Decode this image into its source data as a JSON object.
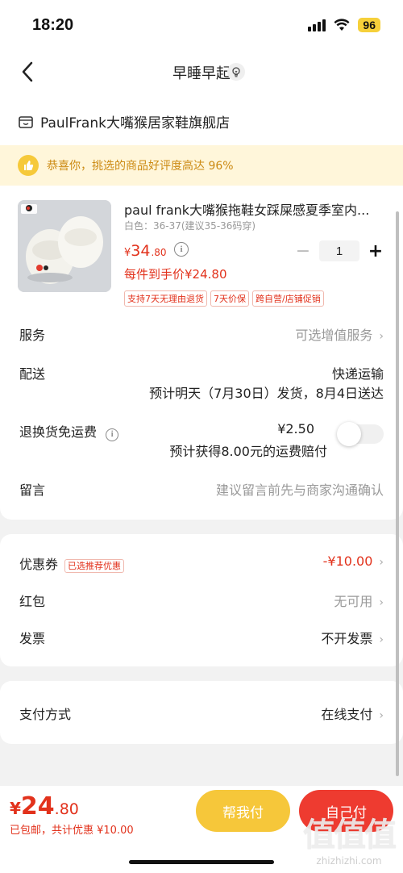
{
  "status": {
    "time": "18:20",
    "battery": "96"
  },
  "nav": {
    "title": "早睡早起"
  },
  "shop": {
    "name": "PaulFrank大嘴猴居家鞋旗舰店"
  },
  "banner": {
    "text": "恭喜你，挑选的商品好评度高达 96%"
  },
  "product": {
    "title": "paul frank大嘴猴拖鞋女踩屎感夏季室内...",
    "spec": "白色：36-37(建议35-36码穿)",
    "price_symbol": "¥",
    "price_int": "34",
    "price_dec": ".80",
    "quantity": "1",
    "unit_price": "每件到手价¥24.80",
    "tags": [
      "支持7天无理由退货",
      "7天价保",
      "跨自营/店铺促销"
    ]
  },
  "rows": {
    "service": {
      "label": "服务",
      "value": "可选增值服务"
    },
    "delivery": {
      "label": "配送",
      "value": "快递运输",
      "note": "预计明天（7月30日）发货，8月4日送达"
    },
    "return": {
      "label": "退换货免运费",
      "value": "¥2.50",
      "note": "预计获得8.00元的运费赔付"
    },
    "message": {
      "label": "留言",
      "placeholder": "建议留言前先与商家沟通确认"
    },
    "coupon": {
      "label": "优惠券",
      "tag": "已选推荐优惠",
      "value": "-¥10.00"
    },
    "redpacket": {
      "label": "红包",
      "value": "无可用"
    },
    "invoice": {
      "label": "发票",
      "value": "不开发票"
    },
    "payment": {
      "label": "支付方式",
      "value": "在线支付"
    }
  },
  "footer": {
    "total_symbol": "¥",
    "total_int": "24",
    "total_dec": ".80",
    "note": "已包邮，共计优惠 ¥10.00",
    "help_button": "帮我付",
    "self_button": "自己付"
  },
  "watermark": {
    "big": "值值值",
    "small": "zhizhizhi.com"
  },
  "colors": {
    "accent_red": "#e2321c",
    "yellow": "#f6c73a",
    "banner_bg": "#fff6da"
  }
}
